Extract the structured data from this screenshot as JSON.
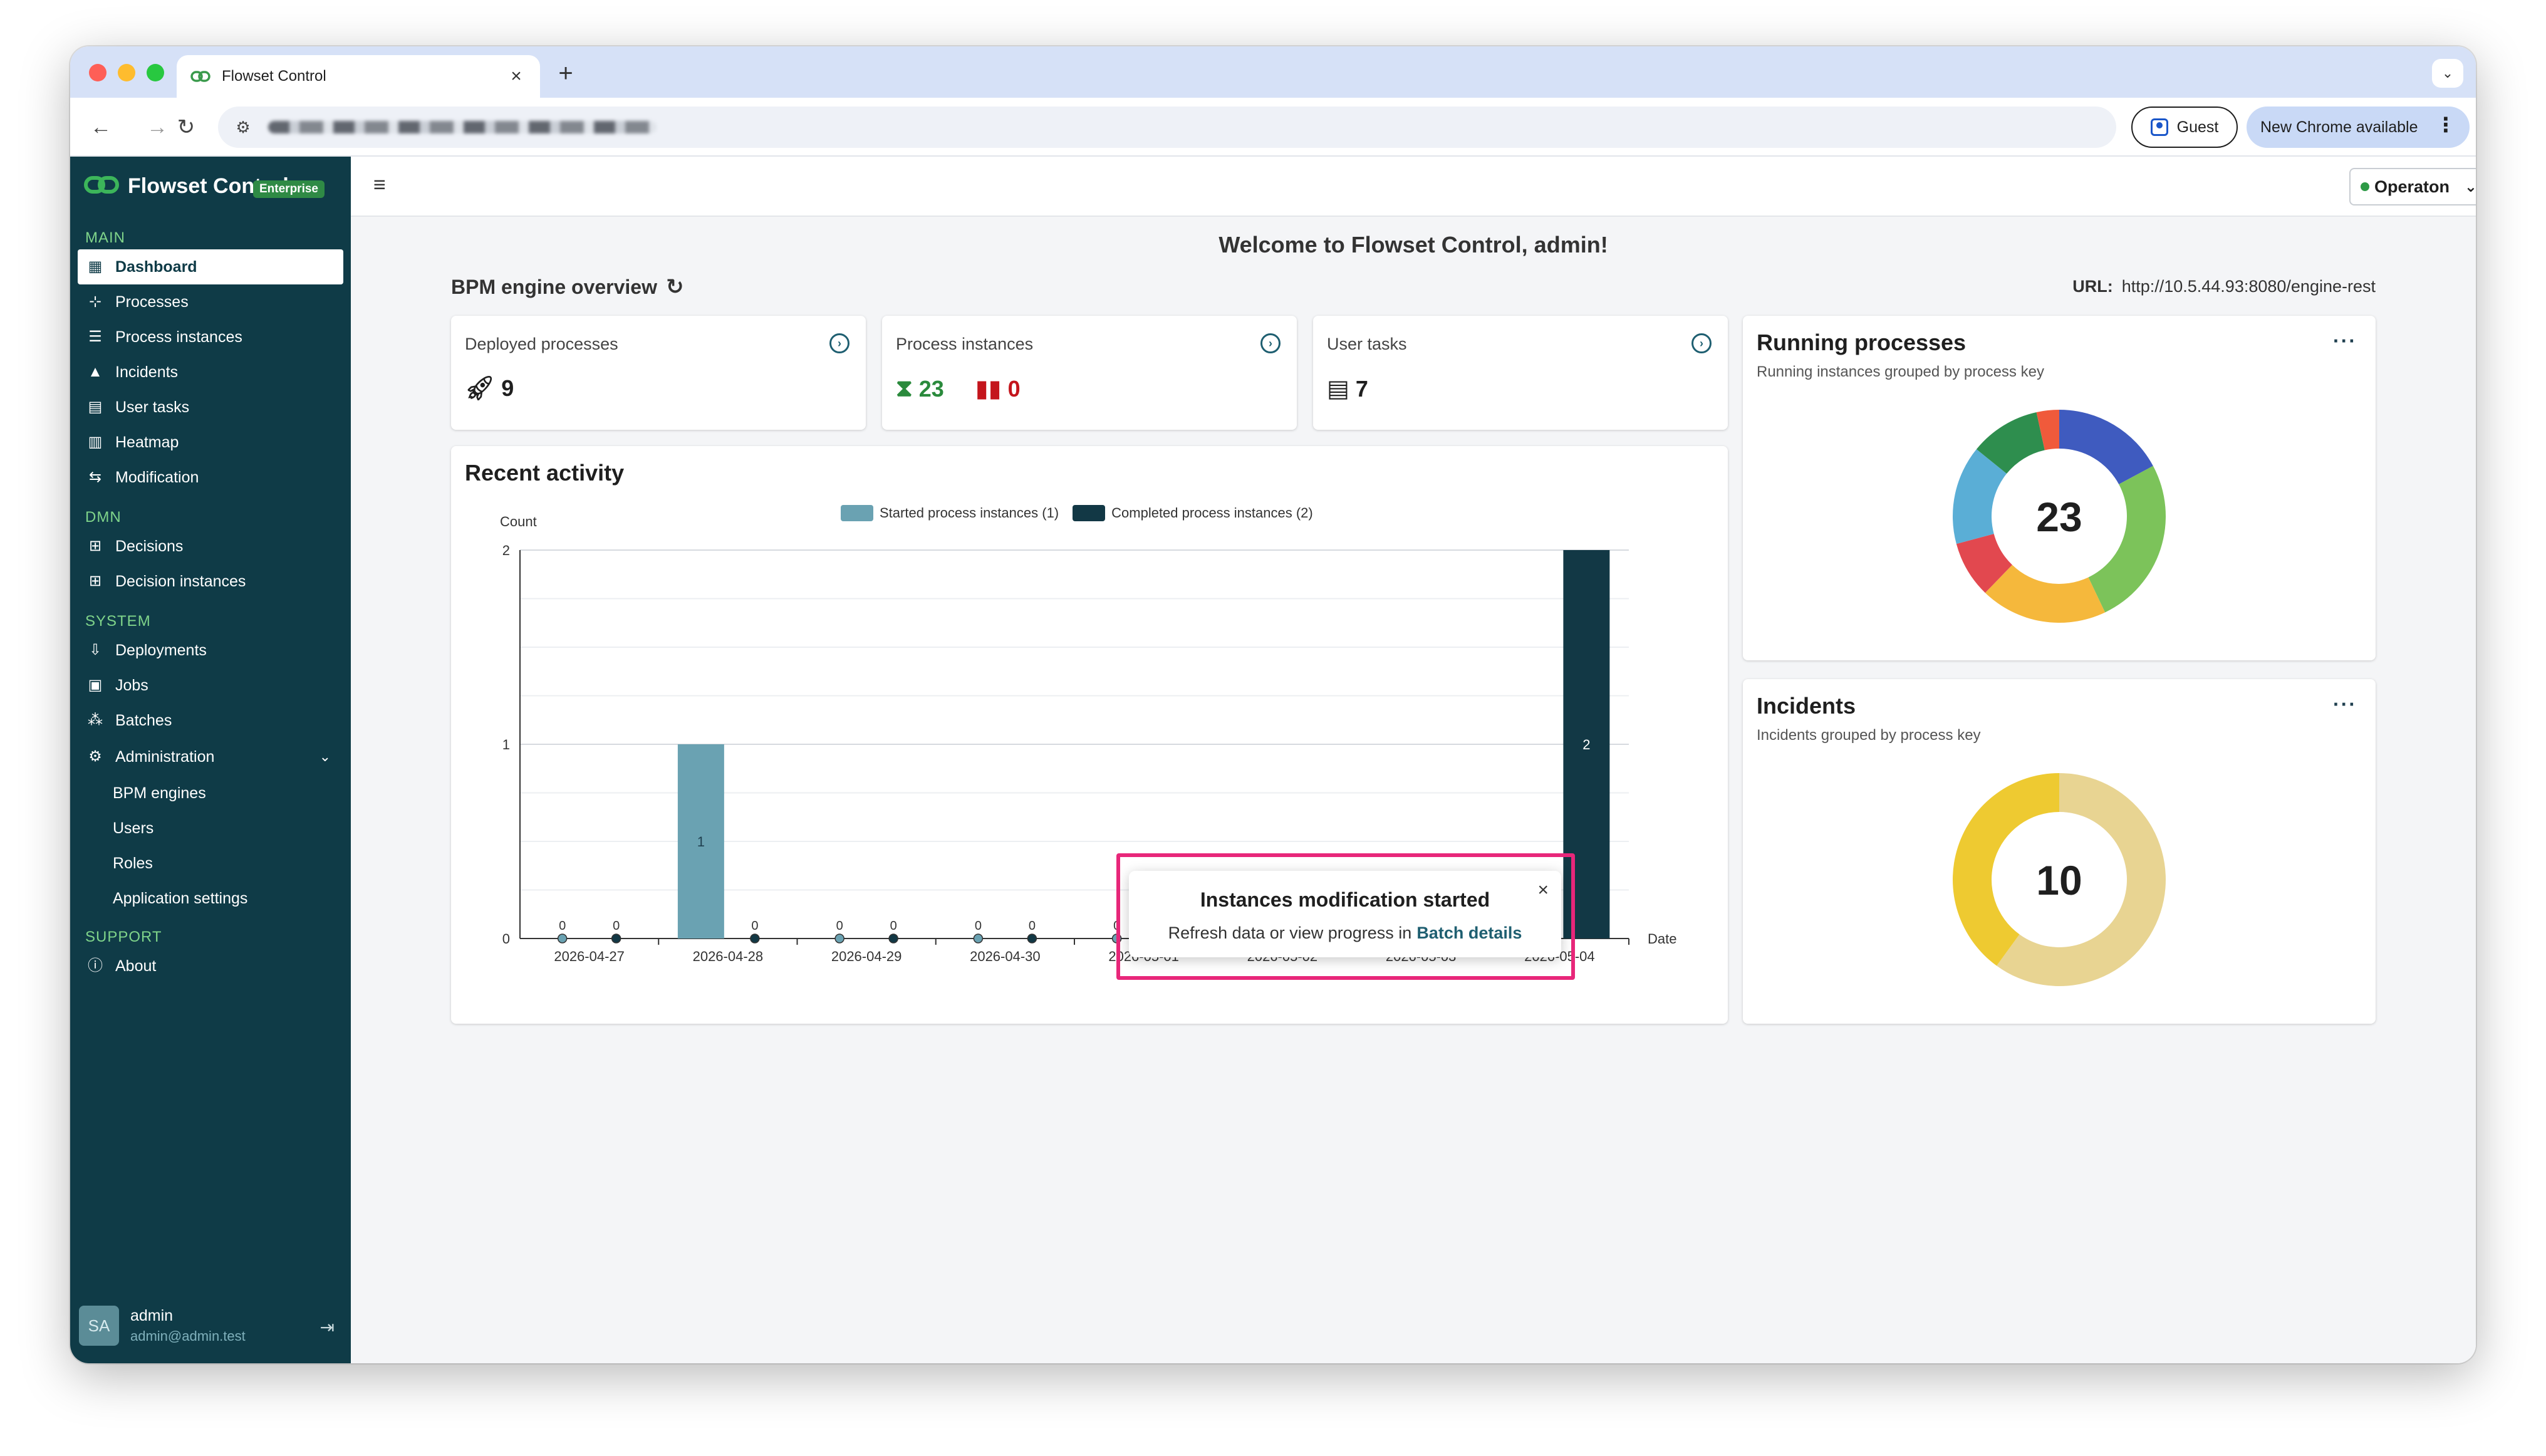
{
  "browser": {
    "tab_title": "Flowset Control",
    "tab_close": "×",
    "new_tab": "+",
    "tab_menu": "⌄",
    "guest_label": "Guest",
    "update_label": "New Chrome available",
    "update_menu": "⋮"
  },
  "brand": {
    "name": "Flowset Control",
    "badge": "Enterprise"
  },
  "sidebar": {
    "sections": [
      {
        "title": "MAIN",
        "items": [
          {
            "label": "Dashboard",
            "icon": "dashboard-icon",
            "active": true
          },
          {
            "label": "Processes",
            "icon": "process-tree-icon"
          },
          {
            "label": "Process instances",
            "icon": "list-icon"
          },
          {
            "label": "Incidents",
            "icon": "warning-icon"
          },
          {
            "label": "User tasks",
            "icon": "id-card-icon"
          },
          {
            "label": "Heatmap",
            "icon": "heatmap-icon"
          },
          {
            "label": "Modification",
            "icon": "modification-icon"
          }
        ]
      },
      {
        "title": "DMN",
        "items": [
          {
            "label": "Decisions",
            "icon": "table-icon"
          },
          {
            "label": "Decision instances",
            "icon": "table-icon"
          }
        ]
      },
      {
        "title": "SYSTEM",
        "items": [
          {
            "label": "Deployments",
            "icon": "deploy-icon"
          },
          {
            "label": "Jobs",
            "icon": "jobs-icon"
          },
          {
            "label": "Batches",
            "icon": "batches-icon"
          },
          {
            "label": "Administration",
            "icon": "gear-icon",
            "expanded": true
          },
          {
            "label": "BPM engines",
            "sub": true
          },
          {
            "label": "Users",
            "sub": true
          },
          {
            "label": "Roles",
            "sub": true
          },
          {
            "label": "Application settings",
            "sub": true
          }
        ]
      },
      {
        "title": "SUPPORT",
        "items": [
          {
            "label": "About",
            "icon": "info-icon"
          }
        ]
      }
    ],
    "user": {
      "initials": "SA",
      "name": "admin",
      "email": "admin@admin.test"
    }
  },
  "topbar": {
    "engine": "Operaton"
  },
  "page": {
    "welcome": "Welcome to Flowset Control, admin!",
    "overview_title": "BPM engine overview",
    "url_label": "URL:",
    "url_value": "http://10.5.44.93:8080/engine-rest"
  },
  "stats": {
    "deployed": {
      "label": "Deployed processes",
      "value": "9"
    },
    "instances": {
      "label": "Process instances",
      "running": "23",
      "suspended": "0"
    },
    "tasks": {
      "label": "User tasks",
      "value": "7"
    }
  },
  "running": {
    "title": "Running processes",
    "subtitle": "Running instances grouped by process key",
    "total": "23",
    "more": "···"
  },
  "incidents": {
    "title": "Incidents",
    "subtitle": "Incidents grouped by process key",
    "total": "10",
    "more": "···"
  },
  "activity": {
    "title": "Recent activity"
  },
  "colors": {
    "started": "#6aa2b2",
    "completed": "#123845",
    "sidebar": "#0f3b47",
    "accent": "#2a8a3c",
    "highlight": "#e8277a"
  },
  "chart_data": [
    {
      "type": "bar",
      "title": "Recent activity",
      "ylabel": "Count",
      "xlabel": "Date",
      "ylim": [
        0,
        2
      ],
      "yticks": [
        0,
        1,
        2
      ],
      "categories": [
        "2026-04-27",
        "2026-04-28",
        "2026-04-29",
        "2026-04-30",
        "2026-05-01",
        "2026-05-02",
        "2026-05-03",
        "2026-05-04"
      ],
      "series": [
        {
          "name": "Started process instances (1)",
          "values": [
            0,
            1,
            0,
            0,
            0,
            0,
            0,
            0
          ]
        },
        {
          "name": "Completed process instances (2)",
          "values": [
            0,
            0,
            0,
            0,
            0,
            0,
            0,
            2
          ]
        }
      ],
      "legend": "top",
      "grid": true
    },
    {
      "type": "pie",
      "title": "Running processes",
      "center_label": "23",
      "slices": [
        {
          "value": 4,
          "color": "#3f5bbf"
        },
        {
          "value": 6,
          "color": "#7cc35a"
        },
        {
          "value": 4.5,
          "color": "#f5b83c"
        },
        {
          "value": 2,
          "color": "#e2484f"
        },
        {
          "value": 3.5,
          "color": "#5aaed6"
        },
        {
          "value": 2.5,
          "color": "#2e8e4e"
        },
        {
          "value": 0.8,
          "color": "#f05a3b"
        }
      ]
    },
    {
      "type": "pie",
      "title": "Incidents",
      "center_label": "10",
      "slices": [
        {
          "value": 6,
          "color": "#e8d492"
        },
        {
          "value": 4,
          "color": "#eeca31"
        }
      ]
    }
  ],
  "toast": {
    "title": "Instances modification started",
    "body": "Refresh data or view progress in",
    "link": "Batch details",
    "close": "×"
  }
}
